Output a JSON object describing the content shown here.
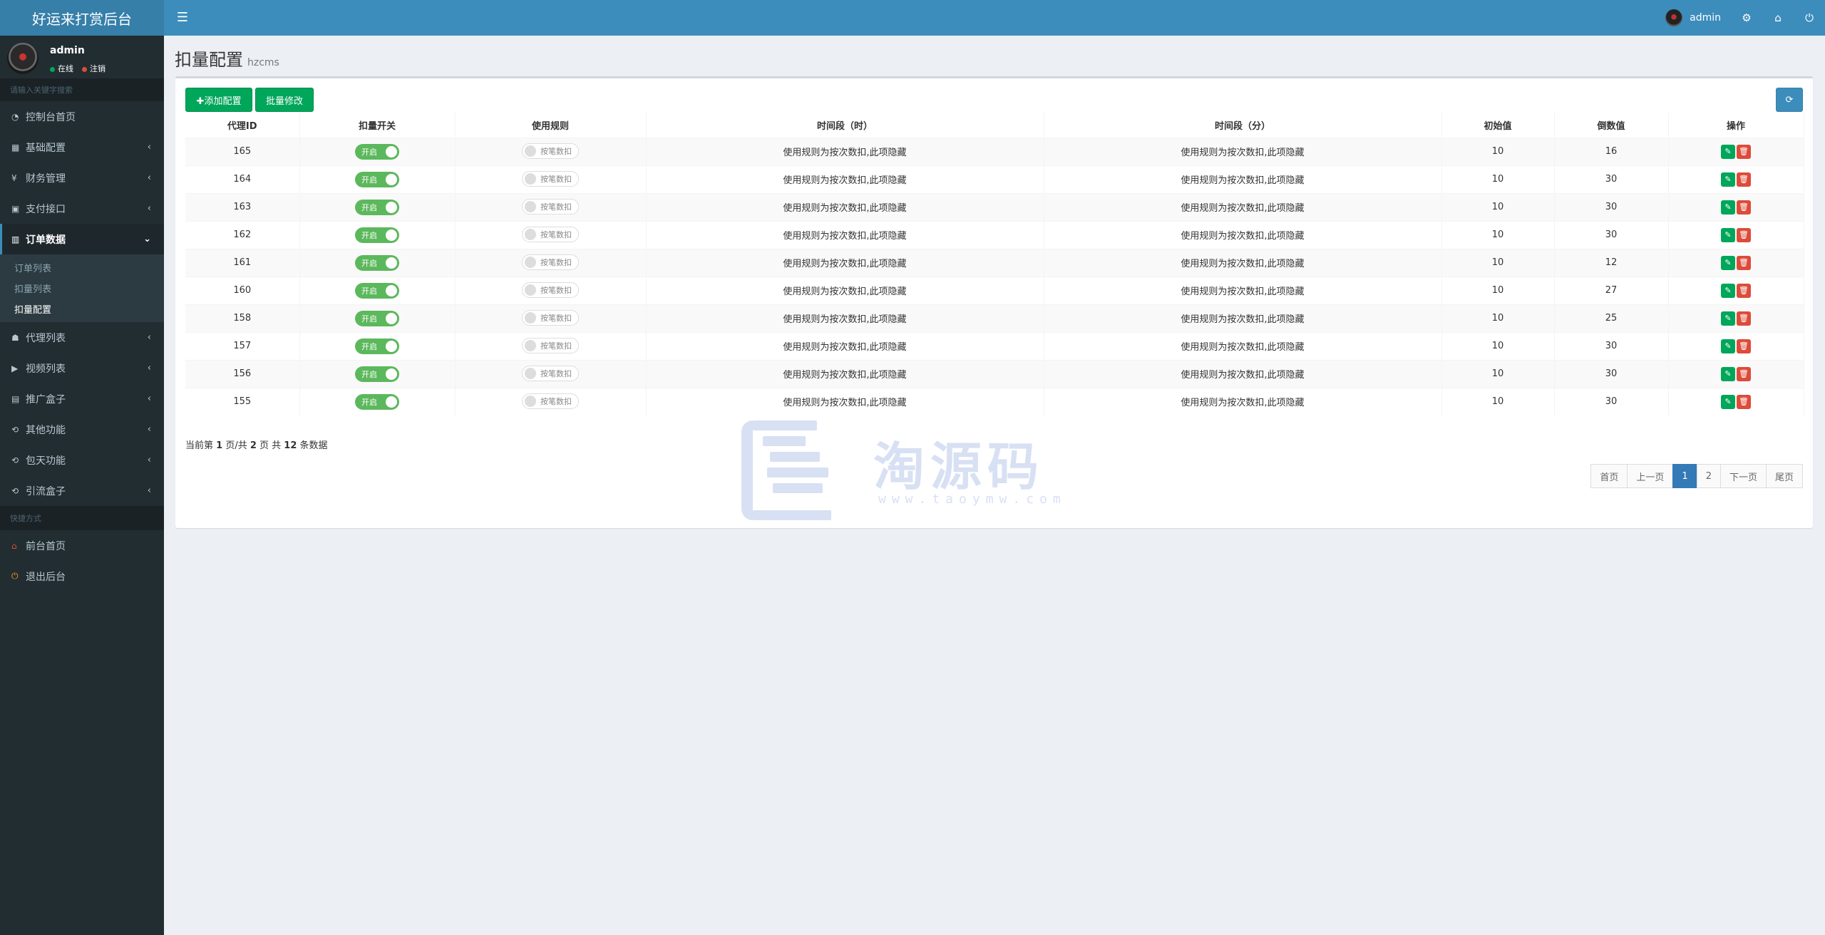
{
  "app": {
    "title": "好运来打赏后台"
  },
  "header": {
    "username": "admin"
  },
  "sidebar": {
    "user": {
      "name": "admin",
      "online": "在线",
      "logout": "注销"
    },
    "search_placeholder": "请输入关键字搜索",
    "items": [
      {
        "label": "控制台首页",
        "icon": "◔",
        "chev": ""
      },
      {
        "label": "基础配置",
        "icon": "▦",
        "chev": "‹"
      },
      {
        "label": "财务管理",
        "icon": "¥",
        "chev": "‹"
      },
      {
        "label": "支付接口",
        "icon": "▣",
        "chev": "‹"
      },
      {
        "label": "订单数据",
        "icon": "▥",
        "chev": "⌄"
      }
    ],
    "submenu": [
      "订单列表",
      "扣量列表",
      "扣量配置"
    ],
    "items2": [
      {
        "label": "代理列表",
        "icon": "☗"
      },
      {
        "label": "视频列表",
        "icon": "▶"
      },
      {
        "label": "推广盒子",
        "icon": "▤"
      },
      {
        "label": "其他功能",
        "icon": "⟲"
      },
      {
        "label": "包天功能",
        "icon": "⟲"
      },
      {
        "label": "引流盒子",
        "icon": "⟲"
      }
    ],
    "quick_header": "快捷方式",
    "quick": [
      {
        "label": "前台首页",
        "icon": "⌂",
        "color": "#dd4b39"
      },
      {
        "label": "退出后台",
        "icon": "⏻",
        "color": "#f39c12"
      }
    ]
  },
  "page": {
    "title": "扣量配置",
    "subtitle": "hzcms"
  },
  "toolbar": {
    "add": "✚添加配置",
    "batch": "批量修改"
  },
  "table": {
    "headers": [
      "代理ID",
      "扣量开关",
      "使用规则",
      "时间段（时）",
      "时间段（分）",
      "初始值",
      "倒数值",
      "操作"
    ],
    "switch_on": "开启",
    "switch_off": "按笔数扣",
    "hidden_text": "使用规则为按次数扣,此项隐藏",
    "rows": [
      {
        "id": "165",
        "init": "10",
        "count": "16"
      },
      {
        "id": "164",
        "init": "10",
        "count": "30"
      },
      {
        "id": "163",
        "init": "10",
        "count": "30"
      },
      {
        "id": "162",
        "init": "10",
        "count": "30"
      },
      {
        "id": "161",
        "init": "10",
        "count": "12"
      },
      {
        "id": "160",
        "init": "10",
        "count": "27"
      },
      {
        "id": "158",
        "init": "10",
        "count": "25"
      },
      {
        "id": "157",
        "init": "10",
        "count": "30"
      },
      {
        "id": "156",
        "init": "10",
        "count": "30"
      },
      {
        "id": "155",
        "init": "10",
        "count": "30"
      }
    ]
  },
  "pagination": {
    "info": {
      "p1": "当前第 ",
      "cur": "1",
      "p2": " 页/共 ",
      "total_pages": "2",
      "p3": " 页 共 ",
      "total": "12",
      "p4": " 条数据"
    },
    "first": "首页",
    "prev": "上一页",
    "pages": [
      "1",
      "2"
    ],
    "next": "下一页",
    "last": "尾页"
  },
  "watermark": {
    "text": "淘源码",
    "url": "www.taoymw.com"
  }
}
